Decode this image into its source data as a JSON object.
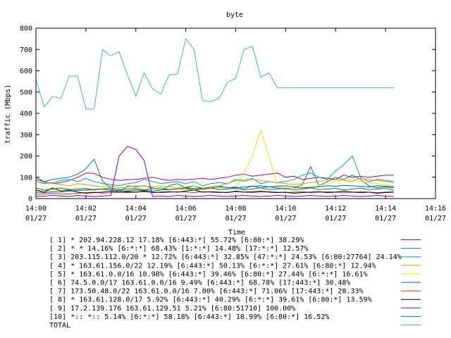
{
  "chart_data": {
    "type": "line",
    "title": "byte",
    "xlabel": "Time",
    "ylabel": "traffic (Mbps)",
    "ylim": [
      0,
      800
    ],
    "xlim": [
      0,
      16
    ],
    "y_ticks": [
      "0",
      "100",
      "200",
      "300",
      "400",
      "500",
      "600",
      "700",
      "800"
    ],
    "x_ticks": [
      {
        "x": 0,
        "time": "14:00",
        "date": "01/27"
      },
      {
        "x": 2,
        "time": "14:02",
        "date": "01/27"
      },
      {
        "x": 4,
        "time": "14:04",
        "date": "01/27"
      },
      {
        "x": 6,
        "time": "14:06",
        "date": "01/27"
      },
      {
        "x": 8,
        "time": "14:08",
        "date": "01/27"
      },
      {
        "x": 10,
        "time": "14:10",
        "date": "01/27"
      },
      {
        "x": 12,
        "time": "14:12",
        "date": "01/27"
      },
      {
        "x": 14,
        "time": "14:14",
        "date": "01/27"
      },
      {
        "x": 16,
        "time": "14:16",
        "date": "01/27"
      }
    ],
    "x": [
      0,
      0.33,
      0.67,
      1,
      1.33,
      1.67,
      2,
      2.33,
      2.67,
      3,
      3.33,
      3.67,
      4,
      4.33,
      4.67,
      5,
      5.33,
      5.67,
      6,
      6.33,
      6.67,
      7,
      7.33,
      7.67,
      8,
      8.33,
      8.67,
      9,
      9.33,
      9.67,
      10,
      10.33,
      10.67,
      11,
      11.33,
      11.67,
      12,
      12.33,
      12.67,
      13,
      13.33,
      13.67,
      14,
      14.33
    ],
    "series": [
      {
        "name": "[ 1] * 202.94.228.12 17.18%  [6:443:*] 55.72% [6:80:*] 38.29%",
        "color": "#a000a0",
        "values": [
          90,
          80,
          70,
          75,
          85,
          100,
          120,
          118,
          100,
          90,
          85,
          88,
          90,
          95,
          100,
          92,
          85,
          90,
          88,
          92,
          95,
          90,
          95,
          100,
          110,
          115,
          105,
          110,
          115,
          120,
          100,
          105,
          90,
          95,
          100,
          95,
          90,
          110,
          100,
          105,
          100,
          105,
          110,
          110
        ]
      },
      {
        "name": "[ 2] * * 14.16%  [6:*:*] 68.43% [1:*:*] 14.48% [17:*:*] 12.57%",
        "color": "#008080",
        "values": [
          100,
          80,
          90,
          95,
          100,
          115,
          140,
          185,
          80,
          50,
          30,
          60,
          55,
          60,
          50,
          40,
          60,
          70,
          50,
          60,
          45,
          55,
          60,
          50,
          55,
          45,
          60,
          50,
          55,
          50,
          45,
          50,
          65,
          150,
          60,
          80,
          100,
          90,
          110,
          90,
          60,
          50,
          55,
          50
        ]
      },
      {
        "name": "[ 3] 203.115.112.0/20 * 12.72%  [6:443:*] 32.85% [47:*:*] 24.53% [6:80:27764] 24.14%",
        "color": "#00a0c0",
        "values": [
          80,
          70,
          75,
          85,
          90,
          80,
          95,
          80,
          70,
          65,
          60,
          70,
          75,
          90,
          80,
          70,
          75,
          80,
          70,
          80,
          60,
          70,
          75,
          70,
          90,
          85,
          95,
          70,
          80,
          75,
          80,
          90,
          110,
          120,
          100,
          90,
          130,
          160,
          200,
          100,
          80,
          90,
          85,
          80
        ]
      },
      {
        "name": "[ 4] * 163.61.156.0/22 12.19%  [6:443:*] 50.13% [6:*:*] 27.61% [6:80:*] 12.94%",
        "color": "#e0a000",
        "values": [
          80,
          75,
          70,
          65,
          60,
          70,
          65,
          60,
          55,
          60,
          50,
          55,
          60,
          58,
          55,
          60,
          55,
          50,
          55,
          60,
          50,
          55,
          60,
          70,
          85,
          80,
          90,
          85,
          80,
          75,
          70,
          65,
          70,
          75,
          80,
          85,
          90,
          85,
          80,
          95,
          90,
          85,
          80,
          75
        ]
      },
      {
        "name": "[ 5] * 163.61.0.0/16 10.98%  [6:443:*] 39.46% [6:80:*] 27.44% [6:*:*] 16.61%",
        "color": "#f0e000",
        "values": [
          40,
          38,
          40,
          42,
          45,
          40,
          42,
          45,
          40,
          42,
          45,
          40,
          42,
          45,
          48,
          42,
          45,
          48,
          40,
          45,
          42,
          45,
          48,
          45,
          50,
          120,
          200,
          320,
          200,
          60,
          50,
          48,
          50,
          55,
          60,
          70,
          80,
          85,
          90,
          80,
          75,
          70,
          65,
          60
        ]
      },
      {
        "name": "[ 6] 74.5.0.0/17 163.61.0.0/16 9.49%  [6:443:*] 68.78% [17:443:*] 30.48%",
        "color": "#0060a0",
        "values": [
          30,
          28,
          32,
          30,
          35,
          38,
          40,
          42,
          45,
          40,
          38,
          35,
          40,
          38,
          35,
          40,
          42,
          45,
          50,
          48,
          45,
          50,
          55,
          52,
          50,
          55,
          58,
          60,
          55,
          58,
          60,
          55,
          50,
          52,
          55,
          60,
          58,
          62,
          60,
          58,
          55,
          60,
          58,
          55
        ]
      },
      {
        "name": "[ 7] 173.50.48.0/22 163.61.0.0/16 7.00%  [6:443:*] 71.06% [17:443:*] 28.33%",
        "color": "#e03000",
        "values": [
          20,
          22,
          25,
          20,
          22,
          25,
          28,
          30,
          25,
          28,
          30,
          28,
          30,
          32,
          30,
          28,
          30,
          32,
          30,
          28,
          32,
          30,
          28,
          30,
          32,
          30,
          28,
          30,
          32,
          30,
          28,
          30,
          32,
          28,
          30,
          32,
          30,
          28,
          30,
          32,
          30,
          28,
          30,
          32
        ]
      },
      {
        "name": "[ 8] * 163.61.128.0/17 5.92%  [6:443:*] 40.29% [6:*:*] 39.61% [6:80:*] 13.59%",
        "color": "#000000",
        "values": [
          40,
          30,
          50,
          35,
          40,
          30,
          25,
          28,
          30,
          35,
          30,
          32,
          30,
          35,
          28,
          30,
          32,
          30,
          35,
          40,
          30,
          32,
          30,
          28,
          35,
          30,
          32,
          35,
          30,
          28,
          30,
          25,
          28,
          30,
          32,
          28,
          30,
          35,
          30,
          28,
          30,
          25,
          28,
          30
        ]
      },
      {
        "name": "[ 9] 17.2.139.176 163.61.129.51 5.21%  [6:80:51710] 100.00%",
        "color": "#8000c0",
        "values": [
          10,
          12,
          15,
          12,
          10,
          15,
          12,
          10,
          12,
          15,
          200,
          245,
          230,
          180,
          10,
          12,
          10,
          15,
          12,
          10,
          12,
          15,
          12,
          10,
          12,
          15,
          12,
          10,
          12,
          15,
          12,
          10,
          12,
          15,
          12,
          10,
          12,
          15,
          12,
          10,
          12,
          15,
          12,
          10
        ]
      },
      {
        "name": "[10] *:: *:: 5.14%  [6:*:*] 58.18% [6:443:*] 18.99% [6:80:*] 16.52%",
        "color": "#008060",
        "values": [
          50,
          40,
          45,
          50,
          42,
          45,
          48,
          40,
          45,
          50,
          42,
          45,
          48,
          40,
          45,
          50,
          42,
          45,
          48,
          40,
          45,
          50,
          42,
          45,
          48,
          40,
          45,
          50,
          42,
          45,
          48,
          40,
          45,
          50,
          42,
          45,
          48,
          40,
          45,
          50,
          42,
          45,
          48,
          40
        ]
      },
      {
        "name": "TOTAL",
        "color": "#40b0d8",
        "values": [
          560,
          430,
          480,
          470,
          575,
          575,
          420,
          420,
          700,
          670,
          690,
          580,
          480,
          590,
          515,
          490,
          580,
          585,
          750,
          700,
          460,
          455,
          470,
          545,
          565,
          700,
          715,
          570,
          590,
          520,
          520,
          520,
          520,
          520,
          520,
          520,
          520,
          520,
          520,
          520,
          520,
          520,
          520,
          520
        ]
      }
    ]
  }
}
